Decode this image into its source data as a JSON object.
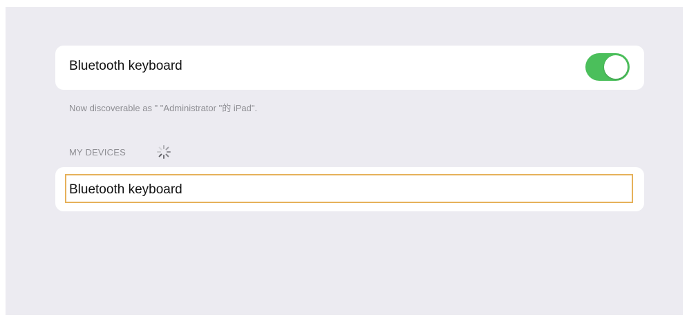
{
  "bluetooth": {
    "toggle_label": "Bluetooth keyboard",
    "toggle_on": true,
    "toggle_color": "#4bbf5b",
    "discoverable_note": "Now discoverable as \" \"Administrator \"的 iPad\"."
  },
  "my_devices": {
    "header": "MY DEVICES",
    "loading_icon": "spinner-icon",
    "items": [
      {
        "label": "Bluetooth keyboard",
        "focused": true,
        "focus_color": "#e6b15a"
      }
    ]
  }
}
